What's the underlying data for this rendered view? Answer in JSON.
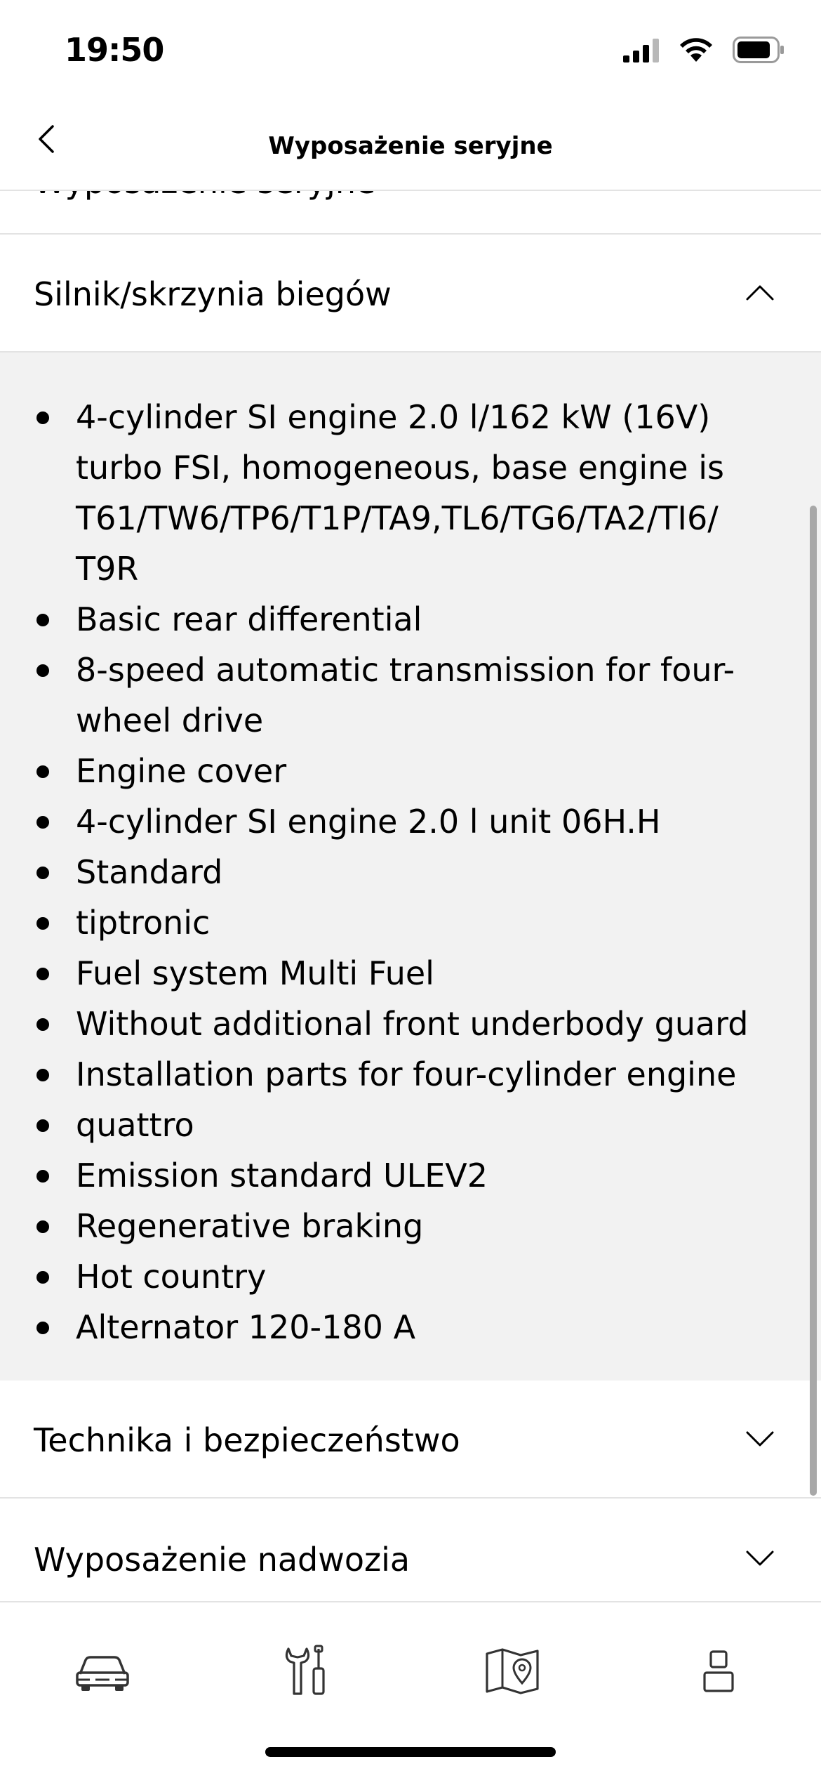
{
  "status_bar": {
    "time": "19:50",
    "icons": [
      "signal-icon",
      "wifi-icon",
      "battery-icon"
    ]
  },
  "header": {
    "title": "Wyposażenie seryjne",
    "back_icon": "chevron-left-icon"
  },
  "previous_section_partial": {
    "label": "Wyposażenie seryjne"
  },
  "sections": [
    {
      "label": "Silnik/skrzynia biegów",
      "expanded": true,
      "chevron_icon": "chevron-up-icon",
      "items": [
        "4-cylinder SI engine 2.0 l/162 kW (16V) turbo FSI, homogeneous, base engine is T61/TW6/TP6/T1P/TA9,TL6/TG6/TA2/TI6/ T9R",
        "Basic rear differential",
        "8-speed automatic transmission for four-wheel drive",
        "Engine cover",
        "4-cylinder SI engine 2.0 l unit 06H.H",
        "Standard",
        "tiptronic",
        "Fuel system Multi Fuel",
        "Without additional front underbody guard",
        "Installation parts for four-cylinder engine",
        "quattro",
        "Emission standard ULEV2",
        "Regenerative braking",
        "Hot country",
        "Alternator 120-180 A"
      ]
    },
    {
      "label": "Technika i bezpieczeństwo",
      "expanded": false,
      "chevron_icon": "chevron-down-icon"
    },
    {
      "label": "Wyposażenie nadwozia",
      "expanded": false,
      "chevron_icon": "chevron-down-icon"
    }
  ],
  "tab_bar": {
    "tabs": [
      {
        "icon": "car-icon",
        "active": true
      },
      {
        "icon": "tools-icon",
        "active": false
      },
      {
        "icon": "map-icon",
        "active": false
      },
      {
        "icon": "user-icon",
        "active": false
      }
    ]
  },
  "colors": {
    "background": "#ffffff",
    "expanded_background": "#f2f2f2",
    "divider": "#e3e3e3",
    "text": "#000000",
    "icon": "#333333"
  }
}
